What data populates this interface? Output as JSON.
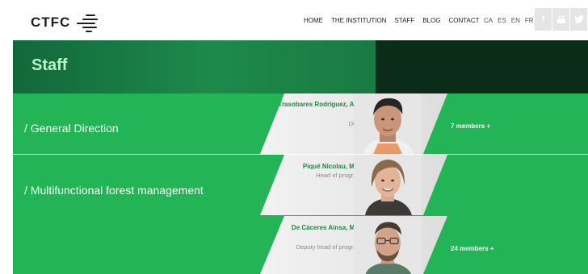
{
  "header": {
    "logo_text": "CTFC",
    "nav": [
      "HOME",
      "THE INSTITUTION",
      "STAFF",
      "BLOG",
      "CONTACT"
    ],
    "languages": [
      "CA",
      "ES",
      "EN",
      "FR"
    ],
    "social_icons": [
      "facebook-icon",
      "youtube-icon",
      "twitter-icon"
    ]
  },
  "banner": {
    "title": "Staff"
  },
  "sections": [
    {
      "title": "/ General Direction",
      "members": "7 members +",
      "people": [
        {
          "name": "Trasobares Rodríguez, Antoni",
          "role": "Director"
        }
      ]
    },
    {
      "title": "/ Multifunctional forest management",
      "members": "24 members +",
      "people": [
        {
          "name": "Piqué Nicolau, Míriam",
          "role": "Head of programme"
        },
        {
          "name": "De Cáceres Ainsa, Miquel",
          "role": "Deputy head of programme"
        }
      ]
    }
  ],
  "colors": {
    "section_green": "#22b455",
    "banner_dark": "#0b2c18",
    "name_green": "#1a8a40"
  }
}
